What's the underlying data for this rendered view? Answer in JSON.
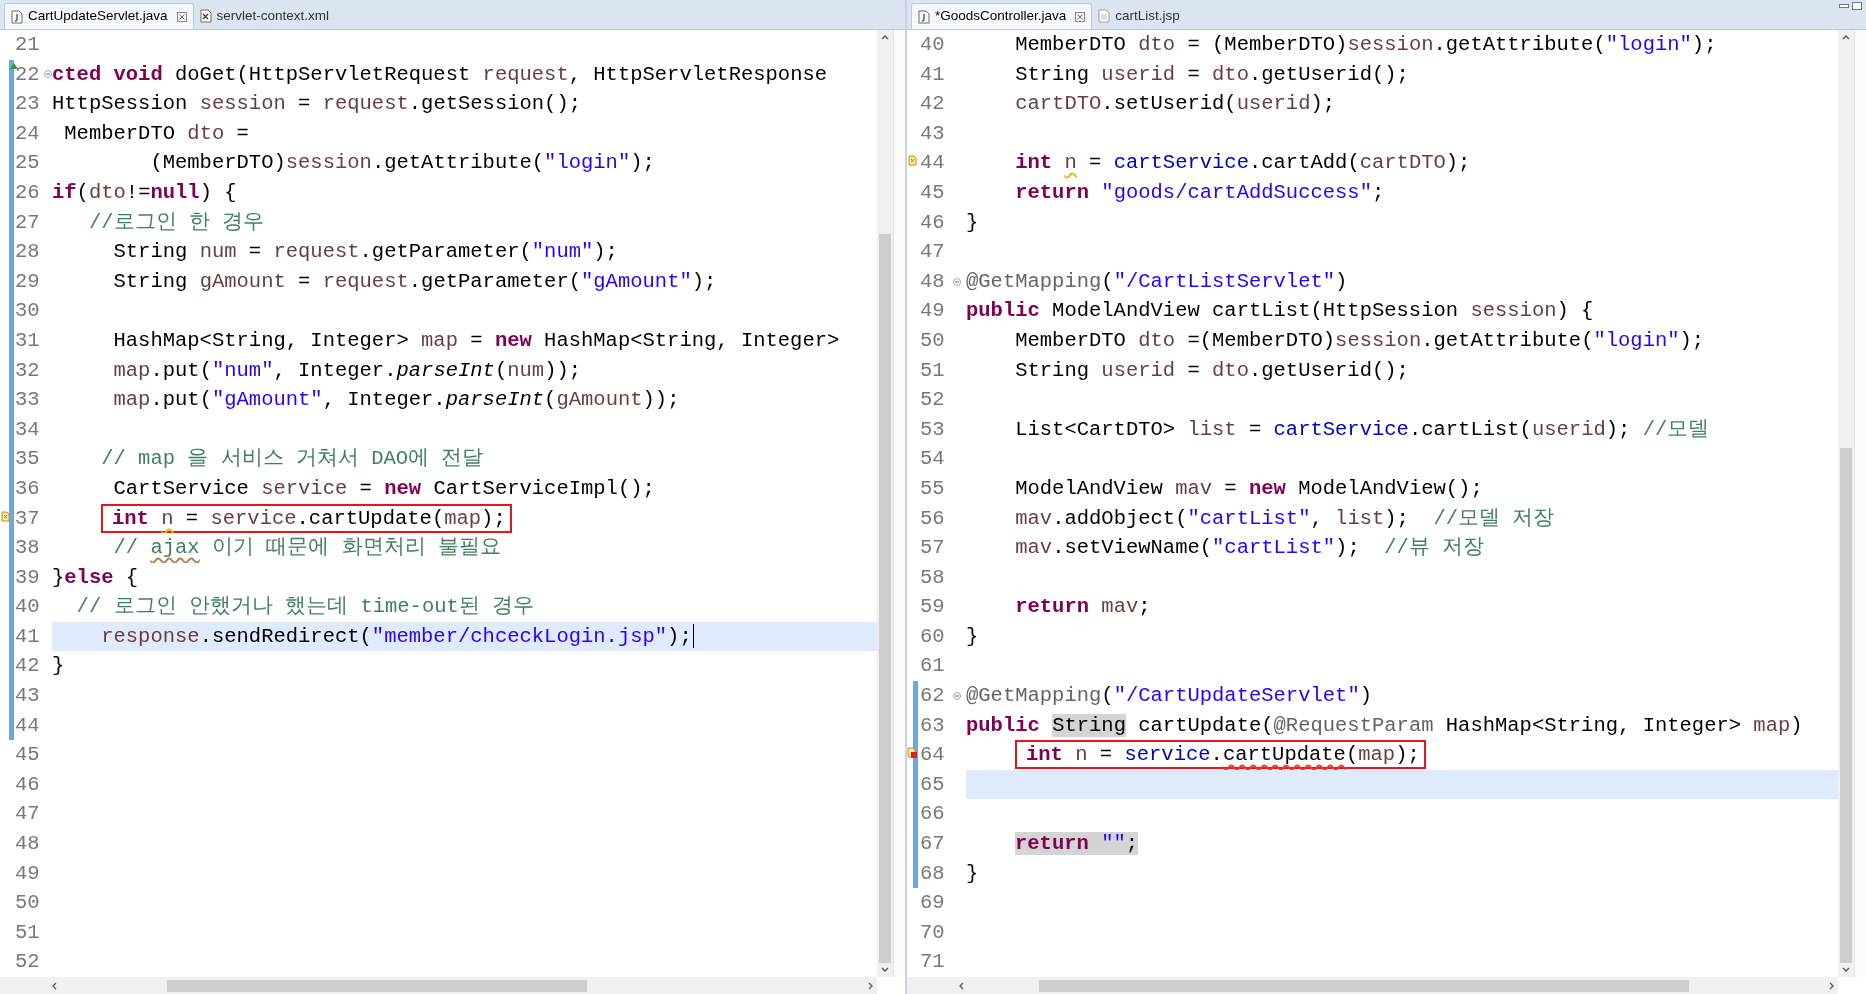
{
  "editors": [
    {
      "tabs": [
        {
          "label": "CartUpdateServlet.java",
          "selected": true,
          "kind": "java",
          "closable": true
        },
        {
          "label": "servlet-context.xml",
          "selected": false,
          "kind": "xml",
          "closable": false
        }
      ],
      "lines": [
        {
          "number": "21",
          "current": false,
          "changed": false
        },
        {
          "number": "22",
          "current": false,
          "changed": true,
          "markers": [
            {
              "kind": "override"
            },
            {
              "kind": "fold"
            }
          ],
          "tokens": [
            {
              "text": "cted void",
              "kind": "kw"
            },
            {
              "text": " doGet(HttpServletRequest ",
              "kind": "plain"
            },
            {
              "text": "request",
              "kind": "var"
            },
            {
              "text": ", HttpServletResponse",
              "kind": "plain"
            }
          ]
        },
        {
          "number": "23",
          "current": false,
          "changed": true,
          "tokens": [
            {
              "text": "HttpSession ",
              "kind": "plain"
            },
            {
              "text": "session",
              "kind": "var"
            },
            {
              "text": " = ",
              "kind": "plain"
            },
            {
              "text": "request",
              "kind": "var"
            },
            {
              "text": ".getSession();",
              "kind": "plain"
            }
          ]
        },
        {
          "number": "24",
          "current": false,
          "changed": true,
          "tokens": [
            {
              "text": " MemberDTO ",
              "kind": "plain"
            },
            {
              "text": "dto",
              "kind": "var"
            },
            {
              "text": " =",
              "kind": "plain"
            }
          ]
        },
        {
          "number": "25",
          "current": false,
          "changed": true,
          "tokens": [
            {
              "text": "        (MemberDTO)",
              "kind": "plain"
            },
            {
              "text": "session",
              "kind": "var"
            },
            {
              "text": ".getAttribute(",
              "kind": "plain"
            },
            {
              "text": "\"login\"",
              "kind": "str"
            },
            {
              "text": ");",
              "kind": "plain"
            }
          ]
        },
        {
          "number": "26",
          "current": false,
          "changed": true,
          "tokens": [
            {
              "text": "if",
              "kind": "kw"
            },
            {
              "text": "(",
              "kind": "plain"
            },
            {
              "text": "dto",
              "kind": "var"
            },
            {
              "text": "!=",
              "kind": "plain"
            },
            {
              "text": "null",
              "kind": "kw"
            },
            {
              "text": ") {",
              "kind": "plain"
            }
          ]
        },
        {
          "number": "27",
          "current": false,
          "changed": true,
          "tokens": [
            {
              "text": "   //로그인 한 경우",
              "kind": "cmt"
            }
          ]
        },
        {
          "number": "28",
          "current": false,
          "changed": true,
          "tokens": [
            {
              "text": "     String ",
              "kind": "plain"
            },
            {
              "text": "num",
              "kind": "var"
            },
            {
              "text": " = ",
              "kind": "plain"
            },
            {
              "text": "request",
              "kind": "var"
            },
            {
              "text": ".getParameter(",
              "kind": "plain"
            },
            {
              "text": "\"num\"",
              "kind": "str"
            },
            {
              "text": ");",
              "kind": "plain"
            }
          ]
        },
        {
          "number": "29",
          "current": false,
          "changed": true,
          "tokens": [
            {
              "text": "     String ",
              "kind": "plain"
            },
            {
              "text": "gAmount",
              "kind": "var"
            },
            {
              "text": " = ",
              "kind": "plain"
            },
            {
              "text": "request",
              "kind": "var"
            },
            {
              "text": ".getParameter(",
              "kind": "plain"
            },
            {
              "text": "\"gAmount\"",
              "kind": "str"
            },
            {
              "text": ");",
              "kind": "plain"
            }
          ]
        },
        {
          "number": "30",
          "current": false,
          "changed": true
        },
        {
          "number": "31",
          "current": false,
          "changed": true,
          "tokens": [
            {
              "text": "     HashMap<String, Integer> ",
              "kind": "plain"
            },
            {
              "text": "map",
              "kind": "var"
            },
            {
              "text": " = ",
              "kind": "plain"
            },
            {
              "text": "new",
              "kind": "kw"
            },
            {
              "text": " HashMap<String, Integer>",
              "kind": "plain"
            }
          ]
        },
        {
          "number": "32",
          "current": false,
          "changed": true,
          "tokens": [
            {
              "text": "     map",
              "kind": "var"
            },
            {
              "text": ".put(",
              "kind": "plain"
            },
            {
              "text": "\"num\"",
              "kind": "str"
            },
            {
              "text": ", Integer.",
              "kind": "plain"
            },
            {
              "text": "parseInt",
              "kind": "static"
            },
            {
              "text": "(",
              "kind": "plain"
            },
            {
              "text": "num",
              "kind": "var"
            },
            {
              "text": "));",
              "kind": "plain"
            }
          ]
        },
        {
          "number": "33",
          "current": false,
          "changed": true,
          "tokens": [
            {
              "text": "     map",
              "kind": "var"
            },
            {
              "text": ".put(",
              "kind": "plain"
            },
            {
              "text": "\"gAmount\"",
              "kind": "str"
            },
            {
              "text": ", Integer.",
              "kind": "plain"
            },
            {
              "text": "parseInt",
              "kind": "static"
            },
            {
              "text": "(",
              "kind": "plain"
            },
            {
              "text": "gAmount",
              "kind": "var"
            },
            {
              "text": "));",
              "kind": "plain"
            }
          ]
        },
        {
          "number": "34",
          "current": false,
          "changed": true
        },
        {
          "number": "35",
          "current": false,
          "changed": true,
          "tokens": [
            {
              "text": "    // map 을 서비스 거쳐서 DAO에 전달",
              "kind": "cmt"
            }
          ]
        },
        {
          "number": "36",
          "current": false,
          "changed": true,
          "tokens": [
            {
              "text": "     CartService ",
              "kind": "plain"
            },
            {
              "text": "service",
              "kind": "var"
            },
            {
              "text": " = ",
              "kind": "plain"
            },
            {
              "text": "new",
              "kind": "kw"
            },
            {
              "text": " CartServiceImpl();",
              "kind": "plain"
            }
          ]
        },
        {
          "number": "37",
          "current": false,
          "changed": true,
          "markers": [
            {
              "kind": "warning"
            }
          ],
          "tokens": [
            {
              "kind": "box",
              "tokens": [
                {
                  "text": "int ",
                  "kind": "kw"
                },
                {
                  "text": "n",
                  "kind": "var",
                  "squiggle": {
                    "kind": "warning"
                  }
                },
                {
                  "text": " = ",
                  "kind": "plain"
                },
                {
                  "text": "service",
                  "kind": "var"
                },
                {
                  "text": ".cartUpdate(",
                  "kind": "plain"
                },
                {
                  "text": "map",
                  "kind": "var"
                },
                {
                  "text": ");",
                  "kind": "plain"
                }
              ]
            }
          ]
        },
        {
          "number": "38",
          "current": false,
          "changed": true,
          "tokens": [
            {
              "text": "     // ",
              "kind": "cmt"
            },
            {
              "text": "ajax",
              "kind": "cmt",
              "squiggle": {
                "kind": "spelling"
              }
            },
            {
              "text": " 이기 때문에 화면처리 불필요",
              "kind": "cmt"
            }
          ]
        },
        {
          "number": "39",
          "current": false,
          "changed": true,
          "tokens": [
            {
              "text": "}",
              "kind": "plain"
            },
            {
              "text": "else",
              "kind": "kw"
            },
            {
              "text": " {",
              "kind": "plain"
            }
          ]
        },
        {
          "number": "40",
          "current": false,
          "changed": true,
          "tokens": [
            {
              "text": "  // 로그인 안했거나 했는데 time-out된 경우",
              "kind": "cmt"
            }
          ]
        },
        {
          "number": "41",
          "current": true,
          "changed": true,
          "caret": true,
          "tokens": [
            {
              "text": "    response",
              "kind": "var"
            },
            {
              "text": ".sendRedirect(",
              "kind": "plain"
            },
            {
              "text": "\"member/chceckLogin.jsp\"",
              "kind": "str"
            },
            {
              "text": ");",
              "kind": "plain"
            }
          ]
        },
        {
          "number": "42",
          "current": false,
          "changed": true,
          "tokens": [
            {
              "text": "}",
              "kind": "plain"
            }
          ]
        },
        {
          "number": "43",
          "current": false,
          "changed": true
        },
        {
          "number": "44",
          "current": false,
          "changed": true
        },
        {
          "number": "45",
          "current": false,
          "changed": false
        },
        {
          "number": "46",
          "current": false,
          "changed": false
        },
        {
          "number": "47",
          "current": false,
          "changed": false
        },
        {
          "number": "48",
          "current": false,
          "changed": false
        },
        {
          "number": "49",
          "current": false,
          "changed": false
        },
        {
          "number": "50",
          "current": false,
          "changed": false
        },
        {
          "number": "51",
          "current": false,
          "changed": false
        },
        {
          "number": "52",
          "current": false,
          "changed": false
        }
      ]
    },
    {
      "tabs": [
        {
          "label": "*GoodsController.java",
          "selected": true,
          "kind": "java",
          "closable": true
        },
        {
          "label": "cartList.jsp",
          "selected": false,
          "kind": "jsp",
          "closable": false
        }
      ],
      "lines": [
        {
          "number": "40",
          "current": false,
          "changed": false,
          "tokens": [
            {
              "text": "    MemberDTO ",
              "kind": "plain"
            },
            {
              "text": "dto",
              "kind": "var"
            },
            {
              "text": " = (MemberDTO)",
              "kind": "plain"
            },
            {
              "text": "session",
              "kind": "var"
            },
            {
              "text": ".getAttribute(",
              "kind": "plain"
            },
            {
              "text": "\"login\"",
              "kind": "str"
            },
            {
              "text": ");",
              "kind": "plain"
            }
          ]
        },
        {
          "number": "41",
          "current": false,
          "changed": false,
          "tokens": [
            {
              "text": "    String ",
              "kind": "plain"
            },
            {
              "text": "userid",
              "kind": "var"
            },
            {
              "text": " = ",
              "kind": "plain"
            },
            {
              "text": "dto",
              "kind": "var"
            },
            {
              "text": ".getUserid();",
              "kind": "plain"
            }
          ]
        },
        {
          "number": "42",
          "current": false,
          "changed": false,
          "tokens": [
            {
              "text": "    cartDTO",
              "kind": "var"
            },
            {
              "text": ".setUserid(",
              "kind": "plain"
            },
            {
              "text": "userid",
              "kind": "var"
            },
            {
              "text": ");",
              "kind": "plain"
            }
          ]
        },
        {
          "number": "43",
          "current": false,
          "changed": false
        },
        {
          "number": "44",
          "current": false,
          "changed": false,
          "markers": [
            {
              "kind": "warning"
            }
          ],
          "tokens": [
            {
              "text": "    int ",
              "kind": "kw"
            },
            {
              "text": "n",
              "kind": "var",
              "squiggle": {
                "kind": "warning"
              }
            },
            {
              "text": " = ",
              "kind": "plain"
            },
            {
              "text": "cartService",
              "kind": "field"
            },
            {
              "text": ".cartAdd(",
              "kind": "plain"
            },
            {
              "text": "cartDTO",
              "kind": "var"
            },
            {
              "text": ");",
              "kind": "plain"
            }
          ]
        },
        {
          "number": "45",
          "current": false,
          "changed": false,
          "tokens": [
            {
              "text": "    return ",
              "kind": "kw"
            },
            {
              "text": "\"goods/cartAddSuccess\"",
              "kind": "str"
            },
            {
              "text": ";",
              "kind": "plain"
            }
          ]
        },
        {
          "number": "46",
          "current": false,
          "changed": false,
          "tokens": [
            {
              "text": "}",
              "kind": "plain"
            }
          ]
        },
        {
          "number": "47",
          "current": false,
          "changed": false
        },
        {
          "number": "48",
          "current": false,
          "changed": false,
          "markers": [
            {
              "kind": "fold"
            }
          ],
          "tokens": [
            {
              "text": "@GetMapping",
              "kind": "ann"
            },
            {
              "text": "(",
              "kind": "plain"
            },
            {
              "text": "\"/CartListServlet\"",
              "kind": "str"
            },
            {
              "text": ")",
              "kind": "plain"
            }
          ]
        },
        {
          "number": "49",
          "current": false,
          "changed": false,
          "tokens": [
            {
              "text": "public",
              "kind": "kw"
            },
            {
              "text": " ModelAndView cartList(HttpSession ",
              "kind": "plain"
            },
            {
              "text": "session",
              "kind": "var"
            },
            {
              "text": ") {",
              "kind": "plain"
            }
          ]
        },
        {
          "number": "50",
          "current": false,
          "changed": false,
          "tokens": [
            {
              "text": "    MemberDTO ",
              "kind": "plain"
            },
            {
              "text": "dto",
              "kind": "var"
            },
            {
              "text": " =(MemberDTO)",
              "kind": "plain"
            },
            {
              "text": "session",
              "kind": "var"
            },
            {
              "text": ".getAttribute(",
              "kind": "plain"
            },
            {
              "text": "\"login\"",
              "kind": "str"
            },
            {
              "text": ");",
              "kind": "plain"
            }
          ]
        },
        {
          "number": "51",
          "current": false,
          "changed": false,
          "tokens": [
            {
              "text": "    String ",
              "kind": "plain"
            },
            {
              "text": "userid",
              "kind": "var"
            },
            {
              "text": " = ",
              "kind": "plain"
            },
            {
              "text": "dto",
              "kind": "var"
            },
            {
              "text": ".getUserid();",
              "kind": "plain"
            }
          ]
        },
        {
          "number": "52",
          "current": false,
          "changed": false
        },
        {
          "number": "53",
          "current": false,
          "changed": false,
          "tokens": [
            {
              "text": "    List<CartDTO> ",
              "kind": "plain"
            },
            {
              "text": "list",
              "kind": "var"
            },
            {
              "text": " = ",
              "kind": "plain"
            },
            {
              "text": "cartService",
              "kind": "field"
            },
            {
              "text": ".cartList(",
              "kind": "plain"
            },
            {
              "text": "userid",
              "kind": "var"
            },
            {
              "text": "); ",
              "kind": "plain"
            },
            {
              "text": "//모델",
              "kind": "cmt"
            }
          ]
        },
        {
          "number": "54",
          "current": false,
          "changed": false
        },
        {
          "number": "55",
          "current": false,
          "changed": false,
          "tokens": [
            {
              "text": "    ModelAndView ",
              "kind": "plain"
            },
            {
              "text": "mav",
              "kind": "var"
            },
            {
              "text": " = ",
              "kind": "plain"
            },
            {
              "text": "new",
              "kind": "kw"
            },
            {
              "text": " ModelAndView();",
              "kind": "plain"
            }
          ]
        },
        {
          "number": "56",
          "current": false,
          "changed": false,
          "tokens": [
            {
              "text": "    mav",
              "kind": "var"
            },
            {
              "text": ".addObject(",
              "kind": "plain"
            },
            {
              "text": "\"cartList\"",
              "kind": "str"
            },
            {
              "text": ", ",
              "kind": "plain"
            },
            {
              "text": "list",
              "kind": "var"
            },
            {
              "text": ");  ",
              "kind": "plain"
            },
            {
              "text": "//모델 저장",
              "kind": "cmt"
            }
          ]
        },
        {
          "number": "57",
          "current": false,
          "changed": false,
          "tokens": [
            {
              "text": "    mav",
              "kind": "var"
            },
            {
              "text": ".setViewName(",
              "kind": "plain"
            },
            {
              "text": "\"cartList\"",
              "kind": "str"
            },
            {
              "text": ");  ",
              "kind": "plain"
            },
            {
              "text": "//뷰 저장",
              "kind": "cmt"
            }
          ]
        },
        {
          "number": "58",
          "current": false,
          "changed": false
        },
        {
          "number": "59",
          "current": false,
          "changed": false,
          "tokens": [
            {
              "text": "    return ",
              "kind": "kw"
            },
            {
              "text": "mav",
              "kind": "var"
            },
            {
              "text": ";",
              "kind": "plain"
            }
          ]
        },
        {
          "number": "60",
          "current": false,
          "changed": false,
          "tokens": [
            {
              "text": "}",
              "kind": "plain"
            }
          ]
        },
        {
          "number": "61",
          "current": false,
          "changed": false
        },
        {
          "number": "62",
          "current": false,
          "changed": true,
          "markers": [
            {
              "kind": "fold"
            }
          ],
          "tokens": [
            {
              "text": "@GetMapping",
              "kind": "ann"
            },
            {
              "text": "(",
              "kind": "plain"
            },
            {
              "text": "\"/CartUpdateServlet\"",
              "kind": "str"
            },
            {
              "text": ")",
              "kind": "plain"
            }
          ]
        },
        {
          "number": "63",
          "current": false,
          "changed": true,
          "tokens": [
            {
              "text": "public ",
              "kind": "kw"
            },
            {
              "text": "String",
              "kind": "plain",
              "occurrence": true
            },
            {
              "text": " cartUpdate(",
              "kind": "plain"
            },
            {
              "text": "@RequestParam",
              "kind": "ann"
            },
            {
              "text": " HashMap<String, Integer> ",
              "kind": "plain"
            },
            {
              "text": "map",
              "kind": "var"
            },
            {
              "text": ")",
              "kind": "plain"
            }
          ]
        },
        {
          "number": "64",
          "current": false,
          "changed": true,
          "markers": [
            {
              "kind": "error"
            }
          ],
          "tokens": [
            {
              "kind": "box",
              "tokens": [
                {
                  "text": "int ",
                  "kind": "kw"
                },
                {
                  "text": "n",
                  "kind": "var"
                },
                {
                  "text": " = ",
                  "kind": "plain"
                },
                {
                  "text": "service",
                  "kind": "field"
                },
                {
                  "text": ".",
                  "kind": "plain"
                },
                {
                  "text": "cartUpdate",
                  "kind": "plain",
                  "squiggle": {
                    "kind": "error"
                  }
                },
                {
                  "text": "(",
                  "kind": "plain"
                },
                {
                  "text": "map",
                  "kind": "var"
                },
                {
                  "text": ");",
                  "kind": "plain"
                }
              ]
            }
          ]
        },
        {
          "number": "65",
          "current": true,
          "changed": true
        },
        {
          "number": "66",
          "current": false,
          "changed": true
        },
        {
          "number": "67",
          "current": false,
          "changed": true,
          "tokens": [
            {
              "kind": "group",
              "tokens": [
                {
                  "text": "return ",
                  "kind": "kw"
                },
                {
                  "text": "\"\"",
                  "kind": "str"
                },
                {
                  "text": ";",
                  "kind": "plain"
                }
              ],
              "occurrence": true
            }
          ]
        },
        {
          "number": "68",
          "current": false,
          "changed": true,
          "tokens": [
            {
              "text": "}",
              "kind": "plain"
            }
          ]
        },
        {
          "number": "69",
          "current": false,
          "changed": false
        },
        {
          "number": "70",
          "current": false,
          "changed": false
        },
        {
          "number": "71",
          "current": false,
          "changed": false
        }
      ]
    }
  ]
}
